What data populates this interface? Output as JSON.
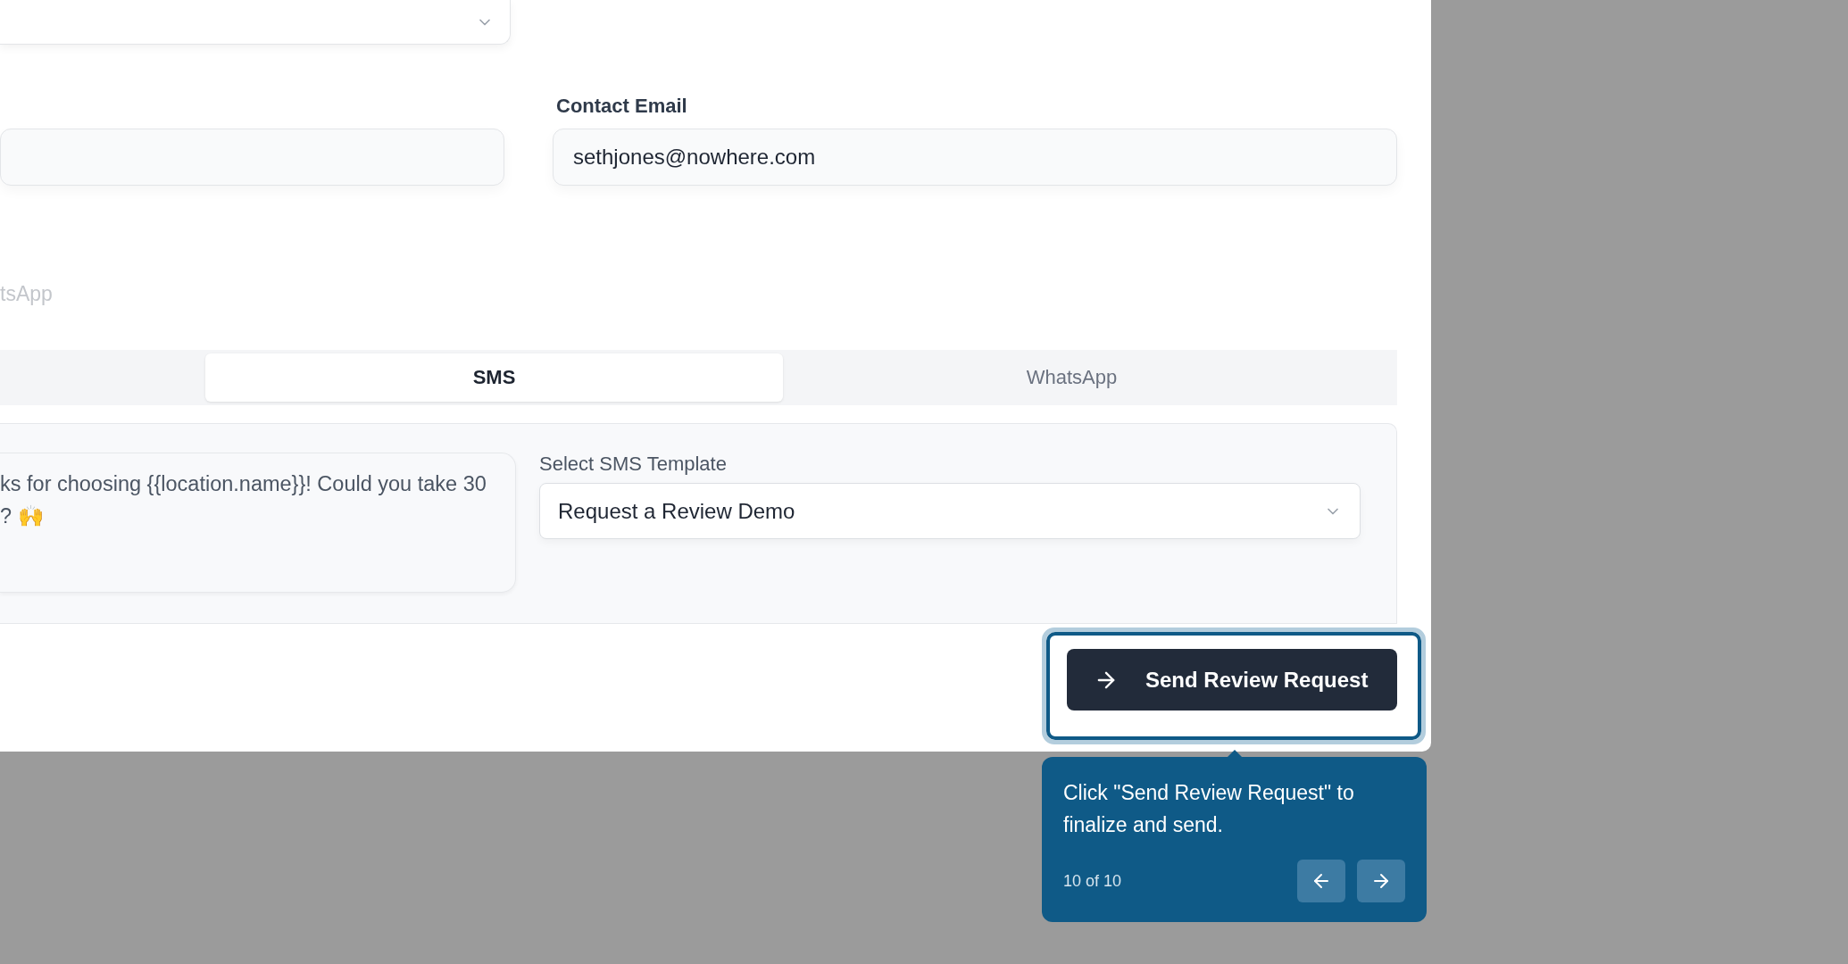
{
  "contact_email": {
    "label": "Contact Email",
    "value": "sethjones@nowhere.com"
  },
  "channel_label": "tsApp",
  "tabs": [
    {
      "label": "SMS",
      "selected": true
    },
    {
      "label": "WhatsApp",
      "selected": false
    }
  ],
  "message_lines": [
    "ks for choosing {{location.name}}! Could you take 30",
    "? 🙌"
  ],
  "template": {
    "label": "Select SMS Template",
    "value": "Request a Review Demo"
  },
  "send_button": {
    "label": "Send Review Request"
  },
  "tour": {
    "text": "Click \"Send Review Request\" to finalize and send.",
    "step": "10 of 10"
  }
}
